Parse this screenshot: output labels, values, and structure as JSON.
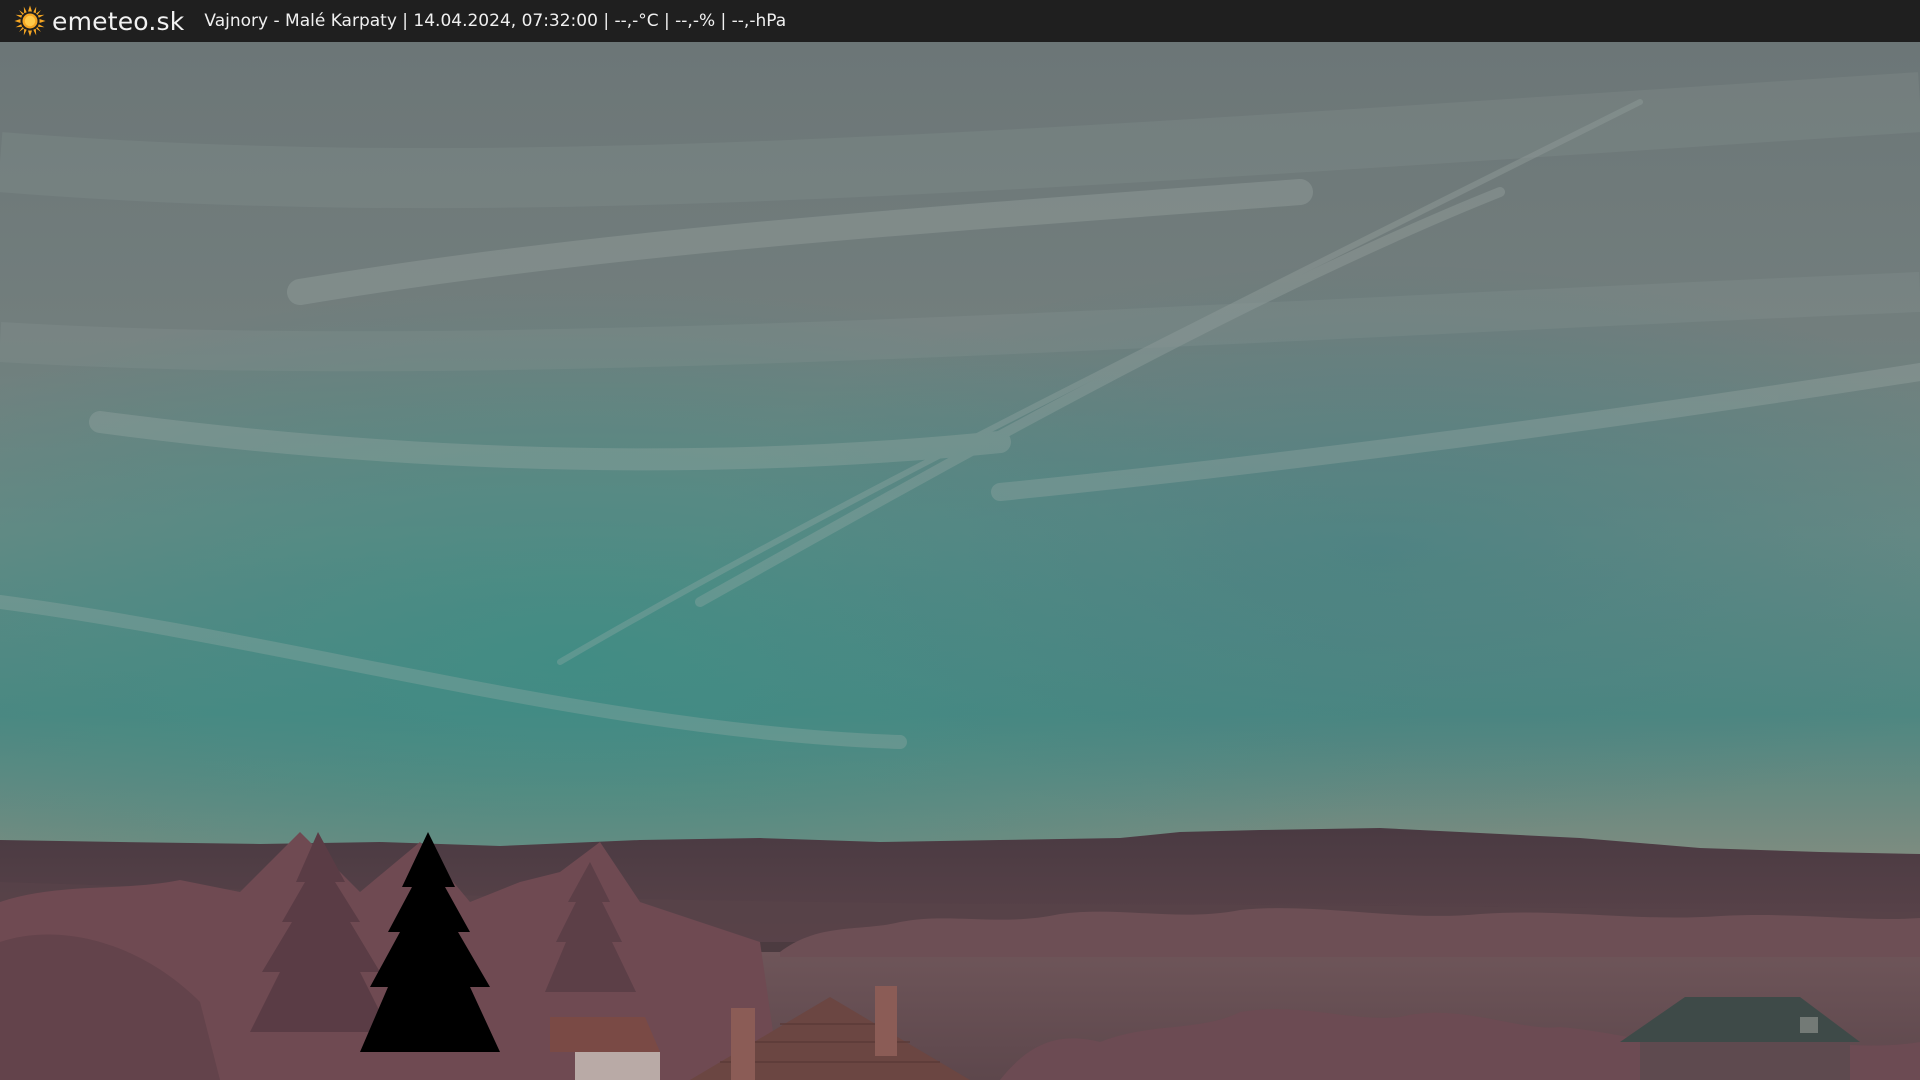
{
  "header": {
    "brand": "emeteo.sk",
    "caption": "Vajnory - Malé Karpaty | 14.04.2024, 07:32:00 | --,-°C | --,-% | --,-hPa",
    "logo_icon": "sun-icon"
  },
  "colors": {
    "bar_background": "#1f1f1f",
    "sun": "#f5a623",
    "sky_top": "#6f7a7b",
    "sky_mid": "#6a8f8a",
    "horizon_teal": "#3f8a82",
    "mountains": "#4c3a40",
    "vegetation": "#7a5259"
  }
}
